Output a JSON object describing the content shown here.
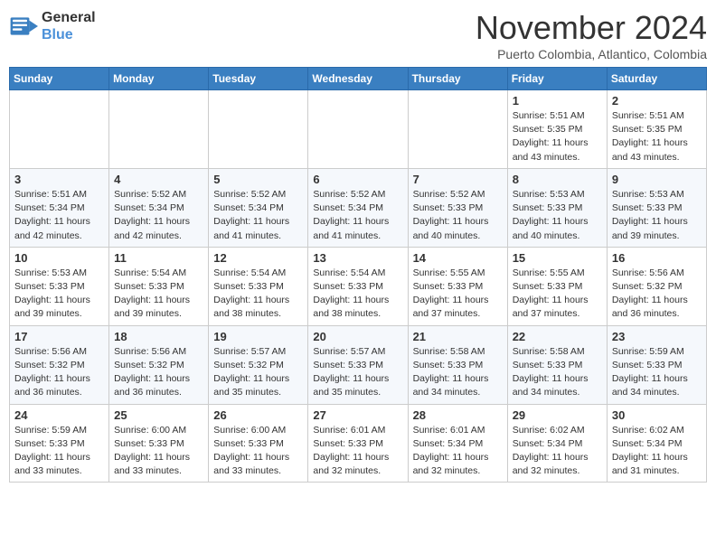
{
  "header": {
    "logo_line1": "General",
    "logo_line2": "Blue",
    "month": "November 2024",
    "location": "Puerto Colombia, Atlantico, Colombia"
  },
  "weekdays": [
    "Sunday",
    "Monday",
    "Tuesday",
    "Wednesday",
    "Thursday",
    "Friday",
    "Saturday"
  ],
  "weeks": [
    [
      {
        "day": "",
        "info": ""
      },
      {
        "day": "",
        "info": ""
      },
      {
        "day": "",
        "info": ""
      },
      {
        "day": "",
        "info": ""
      },
      {
        "day": "",
        "info": ""
      },
      {
        "day": "1",
        "info": "Sunrise: 5:51 AM\nSunset: 5:35 PM\nDaylight: 11 hours\nand 43 minutes."
      },
      {
        "day": "2",
        "info": "Sunrise: 5:51 AM\nSunset: 5:35 PM\nDaylight: 11 hours\nand 43 minutes."
      }
    ],
    [
      {
        "day": "3",
        "info": "Sunrise: 5:51 AM\nSunset: 5:34 PM\nDaylight: 11 hours\nand 42 minutes."
      },
      {
        "day": "4",
        "info": "Sunrise: 5:52 AM\nSunset: 5:34 PM\nDaylight: 11 hours\nand 42 minutes."
      },
      {
        "day": "5",
        "info": "Sunrise: 5:52 AM\nSunset: 5:34 PM\nDaylight: 11 hours\nand 41 minutes."
      },
      {
        "day": "6",
        "info": "Sunrise: 5:52 AM\nSunset: 5:34 PM\nDaylight: 11 hours\nand 41 minutes."
      },
      {
        "day": "7",
        "info": "Sunrise: 5:52 AM\nSunset: 5:33 PM\nDaylight: 11 hours\nand 40 minutes."
      },
      {
        "day": "8",
        "info": "Sunrise: 5:53 AM\nSunset: 5:33 PM\nDaylight: 11 hours\nand 40 minutes."
      },
      {
        "day": "9",
        "info": "Sunrise: 5:53 AM\nSunset: 5:33 PM\nDaylight: 11 hours\nand 39 minutes."
      }
    ],
    [
      {
        "day": "10",
        "info": "Sunrise: 5:53 AM\nSunset: 5:33 PM\nDaylight: 11 hours\nand 39 minutes."
      },
      {
        "day": "11",
        "info": "Sunrise: 5:54 AM\nSunset: 5:33 PM\nDaylight: 11 hours\nand 39 minutes."
      },
      {
        "day": "12",
        "info": "Sunrise: 5:54 AM\nSunset: 5:33 PM\nDaylight: 11 hours\nand 38 minutes."
      },
      {
        "day": "13",
        "info": "Sunrise: 5:54 AM\nSunset: 5:33 PM\nDaylight: 11 hours\nand 38 minutes."
      },
      {
        "day": "14",
        "info": "Sunrise: 5:55 AM\nSunset: 5:33 PM\nDaylight: 11 hours\nand 37 minutes."
      },
      {
        "day": "15",
        "info": "Sunrise: 5:55 AM\nSunset: 5:33 PM\nDaylight: 11 hours\nand 37 minutes."
      },
      {
        "day": "16",
        "info": "Sunrise: 5:56 AM\nSunset: 5:32 PM\nDaylight: 11 hours\nand 36 minutes."
      }
    ],
    [
      {
        "day": "17",
        "info": "Sunrise: 5:56 AM\nSunset: 5:32 PM\nDaylight: 11 hours\nand 36 minutes."
      },
      {
        "day": "18",
        "info": "Sunrise: 5:56 AM\nSunset: 5:32 PM\nDaylight: 11 hours\nand 36 minutes."
      },
      {
        "day": "19",
        "info": "Sunrise: 5:57 AM\nSunset: 5:32 PM\nDaylight: 11 hours\nand 35 minutes."
      },
      {
        "day": "20",
        "info": "Sunrise: 5:57 AM\nSunset: 5:33 PM\nDaylight: 11 hours\nand 35 minutes."
      },
      {
        "day": "21",
        "info": "Sunrise: 5:58 AM\nSunset: 5:33 PM\nDaylight: 11 hours\nand 34 minutes."
      },
      {
        "day": "22",
        "info": "Sunrise: 5:58 AM\nSunset: 5:33 PM\nDaylight: 11 hours\nand 34 minutes."
      },
      {
        "day": "23",
        "info": "Sunrise: 5:59 AM\nSunset: 5:33 PM\nDaylight: 11 hours\nand 34 minutes."
      }
    ],
    [
      {
        "day": "24",
        "info": "Sunrise: 5:59 AM\nSunset: 5:33 PM\nDaylight: 11 hours\nand 33 minutes."
      },
      {
        "day": "25",
        "info": "Sunrise: 6:00 AM\nSunset: 5:33 PM\nDaylight: 11 hours\nand 33 minutes."
      },
      {
        "day": "26",
        "info": "Sunrise: 6:00 AM\nSunset: 5:33 PM\nDaylight: 11 hours\nand 33 minutes."
      },
      {
        "day": "27",
        "info": "Sunrise: 6:01 AM\nSunset: 5:33 PM\nDaylight: 11 hours\nand 32 minutes."
      },
      {
        "day": "28",
        "info": "Sunrise: 6:01 AM\nSunset: 5:34 PM\nDaylight: 11 hours\nand 32 minutes."
      },
      {
        "day": "29",
        "info": "Sunrise: 6:02 AM\nSunset: 5:34 PM\nDaylight: 11 hours\nand 32 minutes."
      },
      {
        "day": "30",
        "info": "Sunrise: 6:02 AM\nSunset: 5:34 PM\nDaylight: 11 hours\nand 31 minutes."
      }
    ]
  ]
}
